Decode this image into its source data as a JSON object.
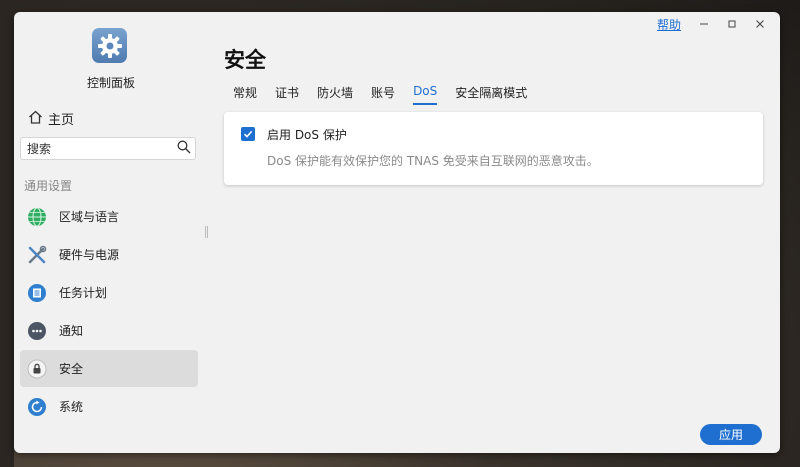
{
  "window": {
    "help_label": "帮助"
  },
  "sidebar": {
    "app_title": "控制面板",
    "home_label": "主页",
    "search_placeholder": "搜索",
    "section_label": "通用设置",
    "items": [
      {
        "label": "区域与语言",
        "icon": "globe-icon"
      },
      {
        "label": "硬件与电源",
        "icon": "tools-icon"
      },
      {
        "label": "任务计划",
        "icon": "task-list-icon"
      },
      {
        "label": "通知",
        "icon": "chat-bubble-icon"
      },
      {
        "label": "安全",
        "icon": "lock-icon",
        "active": true
      },
      {
        "label": "系统",
        "icon": "system-refresh-icon"
      }
    ]
  },
  "main": {
    "title": "安全",
    "tabs": [
      {
        "label": "常规"
      },
      {
        "label": "证书"
      },
      {
        "label": "防火墙"
      },
      {
        "label": "账号"
      },
      {
        "label": "DoS",
        "active": true
      },
      {
        "label": "安全隔离模式"
      }
    ],
    "dos": {
      "enable_label": "启用 DoS 保护",
      "enabled": true,
      "description": "DoS 保护能有效保护您的 TNAS 免受来自互联网的恶意攻击。"
    },
    "apply_label": "应用"
  },
  "colors": {
    "accent": "#1f6fd1",
    "active_nav_bg": "#dcdcdc"
  }
}
